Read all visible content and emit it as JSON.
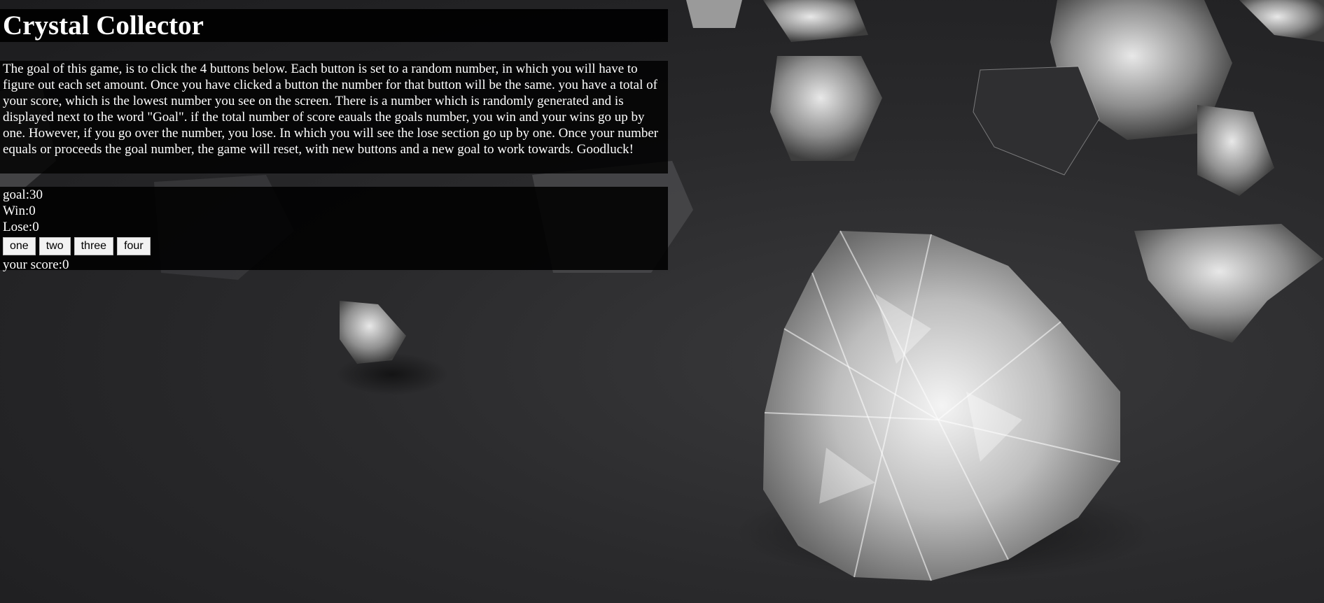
{
  "title": "Crystal Collector",
  "intro": "The goal of this game, is to click the 4 buttons below. Each button is set to a random number, in which you will have to figure out each set amount. Once you have clicked a button the number for that button will be the same. you have a total of your score, which is the lowest number you see on the screen. There is a number which is randomly generated and is displayed next to the word \"Goal\". if the total number of score eauals the goals number, you win and your wins go up by one. However, if you go over the number, you lose. In which you will see the lose section go up by one. Once your number equals or proceeds the goal number, the game will reset, with new buttons and a new goal to work towards. Goodluck!",
  "stats": {
    "goal": "goal:30",
    "win": "Win:0",
    "lose": "Lose:0",
    "score": "your score:0"
  },
  "buttons": [
    "one",
    "two",
    "three",
    "four"
  ],
  "colors": {
    "panel": "#000000",
    "text": "#ffffff",
    "background": "#2a2a2c"
  }
}
